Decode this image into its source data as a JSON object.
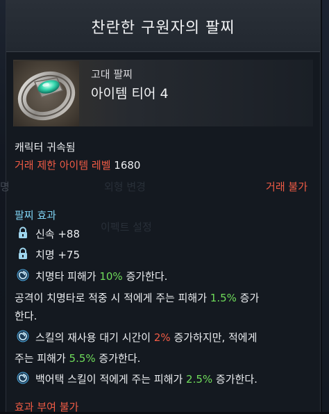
{
  "title": "찬란한 구원자의 팔찌",
  "item": {
    "grade": "고대 팔찌",
    "tier": "아이템 티어 4"
  },
  "binding": "캐릭터 귀속됨",
  "trade_limit": {
    "label": "거래 제한 아이템 레벨",
    "level": "1680"
  },
  "trade_status": "거래 불가",
  "effects": {
    "header": "팔찌 효과",
    "stats": [
      {
        "icon": "lock-icon",
        "text": "신속 +88"
      },
      {
        "icon": "lock-icon",
        "text": "치명 +75"
      }
    ],
    "effect1": {
      "pre": "치명타 피해가 ",
      "value": "10%",
      "post": " 증가한다."
    },
    "effect2": {
      "line1_pre": "공격이 치명타로 적중 시 적에게 주는 피해가 ",
      "line1_value": "1.5%",
      "line1_post": " 증가",
      "line2": "한다."
    },
    "effect3": {
      "line1_pre": "스킬의 재사용 대기 시간이 ",
      "line1_value": "2%",
      "line1_post": " 증가하지만, 적에게",
      "line2_pre": "주는 피해가 ",
      "line2_value": "5.5%",
      "line2_post": " 증가한다."
    },
    "effect4": {
      "pre": "백어택 스킬이 적에게 주는 피해가 ",
      "value": "2.5%",
      "post": " 증가한다."
    }
  },
  "bottom_notice": "효과 부여 불가",
  "background_ghost": {
    "btn1": "외형 변경",
    "btn2": "이펙트 설정",
    "side_label": "명"
  },
  "colors": {
    "warning": "#f05b45",
    "section": "#7fd3f3",
    "value_green": "#6fdc5a"
  }
}
